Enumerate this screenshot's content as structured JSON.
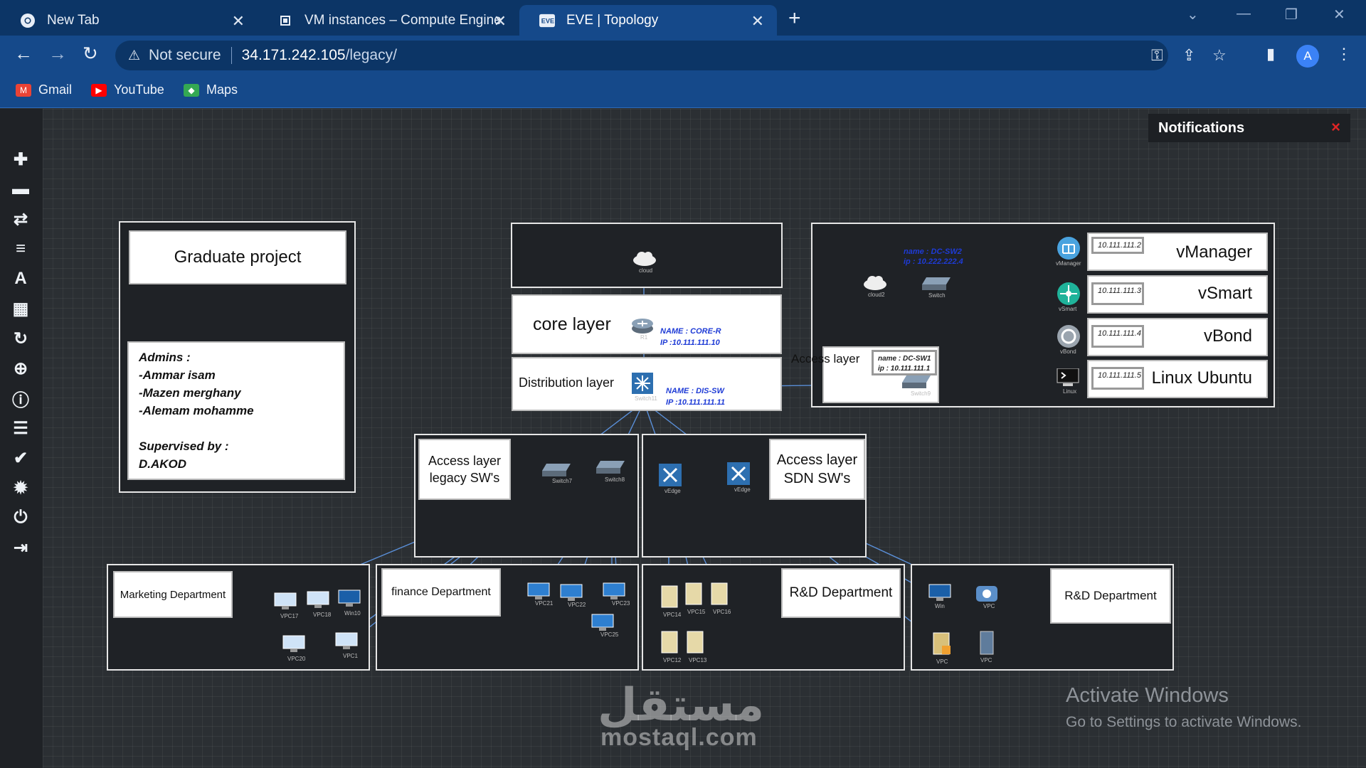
{
  "browser": {
    "tabs": [
      {
        "label": "New Tab",
        "icon": "chrome-icon",
        "active": false
      },
      {
        "label": "VM instances – Compute Engine",
        "icon": "compute-engine-icon",
        "active": false
      },
      {
        "label": "EVE | Topology",
        "icon": "eve-icon",
        "active": true
      }
    ],
    "url_security": "Not secure",
    "url_host": "34.171.242.105",
    "url_path": "/legacy/",
    "avatar_letter": "A",
    "bookmarks": [
      {
        "label": "Gmail",
        "icon": "gmail-icon"
      },
      {
        "label": "YouTube",
        "icon": "youtube-icon"
      },
      {
        "label": "Maps",
        "icon": "maps-icon"
      }
    ]
  },
  "sidebar": {
    "icons": [
      "add-node-icon",
      "nodes-icon",
      "networks-icon",
      "startup-configs-icon",
      "text-object-icon",
      "grid-icon",
      "refresh-icon",
      "zoom-icon",
      "info-icon",
      "logs-icon",
      "status-icon",
      "settings-icon",
      "power-icon",
      "logout-icon"
    ]
  },
  "notifications": {
    "title": "Notifications",
    "close": "×"
  },
  "topology": {
    "project_title": "Graduate project",
    "credits": {
      "admins_heading": "Admins :",
      "admins": [
        "-Ammar isam",
        "-Mazen merghany",
        "-Alemam mohamme"
      ],
      "supervisor_heading": "Supervised by :",
      "supervisor": "D.AKOD"
    },
    "layers": {
      "core": "core layer",
      "distribution": "Distribution layer",
      "access_legacy": "Access layer legacy SW's",
      "access_sdn": "Access layer SDN SW's",
      "access_dc": "Access layer"
    },
    "notes": {
      "core": "NAME : CORE-R",
      "core_ip": "IP :10.111.111.10",
      "dist": "NAME : DIS-SW",
      "dist_ip": "IP :10.111.111.11",
      "dc_sw1": "name : DC-SW1",
      "dc_sw1_ip": "ip : 10.111.111.1",
      "dc_sw2": "name : DC-SW2",
      "dc_sw2_ip": "ip : 10.222.222.4"
    },
    "sdwan": [
      {
        "ip": "10.111.111.2",
        "name": "vManager"
      },
      {
        "ip": "10.111.111.3",
        "name": "vSmart"
      },
      {
        "ip": "10.111.111.4",
        "name": "vBond"
      },
      {
        "ip": "10.111.111.5",
        "name": "Linux Ubuntu"
      }
    ],
    "departments": [
      "Marketing Department",
      "finance Department",
      "R&D Department",
      "R&D Department"
    ],
    "node_labels": {
      "cloud": "cloud",
      "cloud2": "cloud2",
      "r1": "R1",
      "switch11": "Switch11",
      "switch": "Switch",
      "switch9": "Switch9",
      "switch7": "Switch7",
      "switch8": "Switch8",
      "vedge1": "vEdge",
      "vedge2": "vEdge",
      "vmanager": "vManager",
      "vsmart": "vSmart",
      "vbond": "vBond",
      "linux": "Linux"
    },
    "hosts": [
      "VPC17",
      "VPC18",
      "Win10",
      "VPC20",
      "VPC1",
      "VPC21",
      "VPC22",
      "VPC23",
      "VPC25",
      "VPC14",
      "VPC15",
      "VPC16",
      "VPC12",
      "VPC13",
      "Win",
      "VPC",
      "VPC",
      "VPC"
    ]
  },
  "watermark": {
    "activate_title": "Activate Windows",
    "activate_sub": "Go to Settings to activate Windows.",
    "brand_ar": "مستقل",
    "brand_en": "mostaql.com"
  }
}
